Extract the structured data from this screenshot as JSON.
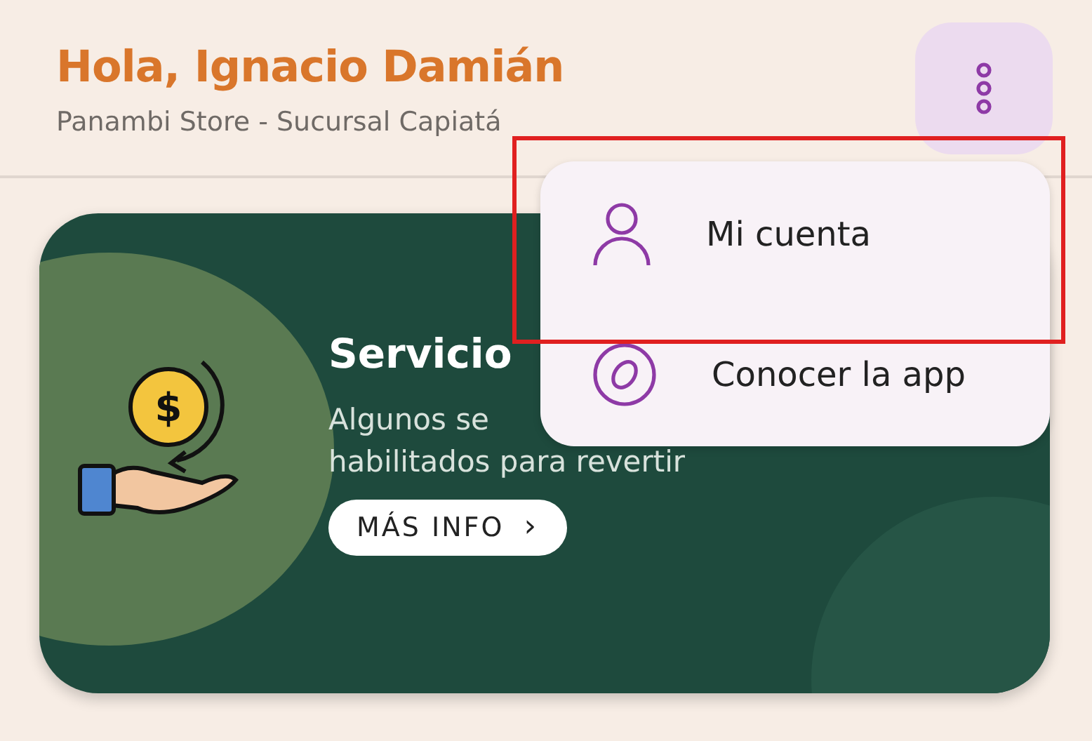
{
  "header": {
    "greeting": "Hola, Ignacio Damián",
    "store": "Panambi Store - Sucursal Capiatá"
  },
  "card": {
    "coin_symbol": "$",
    "title": "Servicio",
    "lines": [
      "Algunos se",
      "habilitados para revertir"
    ],
    "button": {
      "label": "MÁS INFO",
      "chevron": "›"
    }
  },
  "menu": {
    "items": [
      {
        "label": "Mi cuenta",
        "kind": "account"
      },
      {
        "label": "Conocer la app",
        "kind": "tour"
      }
    ]
  }
}
